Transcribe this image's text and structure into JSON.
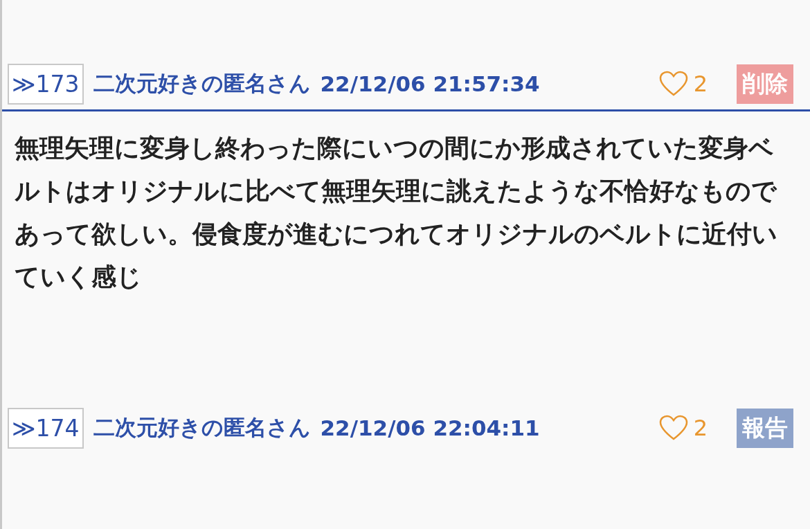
{
  "posts": [
    {
      "anchor": "≫173",
      "author": "二次元好きの匿名さん",
      "date": "22/12/06 21:57:34",
      "likes": "2",
      "action": {
        "kind": "delete",
        "label": "削除"
      },
      "body": "無理矢理に変身し終わった際にいつの間にか形成されていた変身ベルトはオリジナルに比べて無理矢理に誂えたような不恰好なものであって欲しい。侵食度が進むにつれてオリジナルのベルトに近付いていく感じ"
    },
    {
      "anchor": "≫174",
      "author": "二次元好きの匿名さん",
      "date": "22/12/06 22:04:11",
      "likes": "2",
      "action": {
        "kind": "report",
        "label": "報告"
      }
    }
  ]
}
